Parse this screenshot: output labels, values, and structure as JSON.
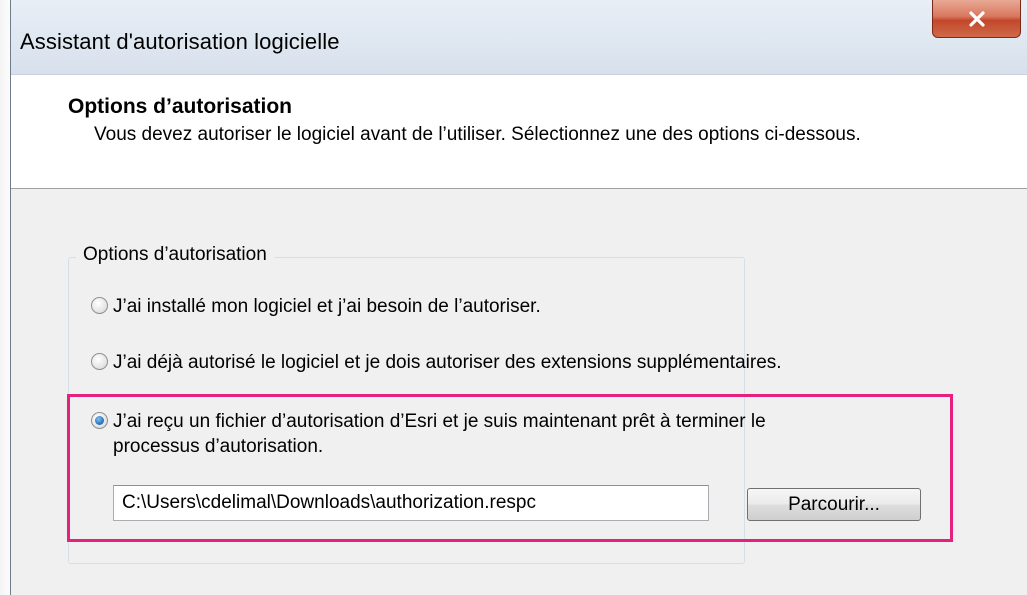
{
  "window": {
    "title": "Assistant d'autorisation logicielle",
    "close_label": "x"
  },
  "header": {
    "title": "Options d’autorisation",
    "description": "Vous devez autoriser le logiciel avant de l’utiliser. Sélectionnez une des options ci-dessous."
  },
  "options_group": {
    "legend": "Options d’autorisation",
    "options": [
      {
        "label": "J’ai installé mon logiciel et j’ai besoin de l’autoriser.",
        "checked": false
      },
      {
        "label": "J’ai déjà autorisé le logiciel et je dois autoriser des extensions supplémentaires.",
        "checked": false
      },
      {
        "label": "J’ai reçu un fichier d’autorisation d’Esri et je suis maintenant prêt à terminer le processus d’autorisation.",
        "checked": true
      }
    ]
  },
  "file_path": {
    "value": "C:\\Users\\cdelimal\\Downloads\\authorization.respc"
  },
  "browse_button": {
    "label": "Parcourir..."
  },
  "colors": {
    "highlight_border": "#e6207f",
    "radio_selected": "#2a78c4",
    "close_button": "#c3472a"
  }
}
